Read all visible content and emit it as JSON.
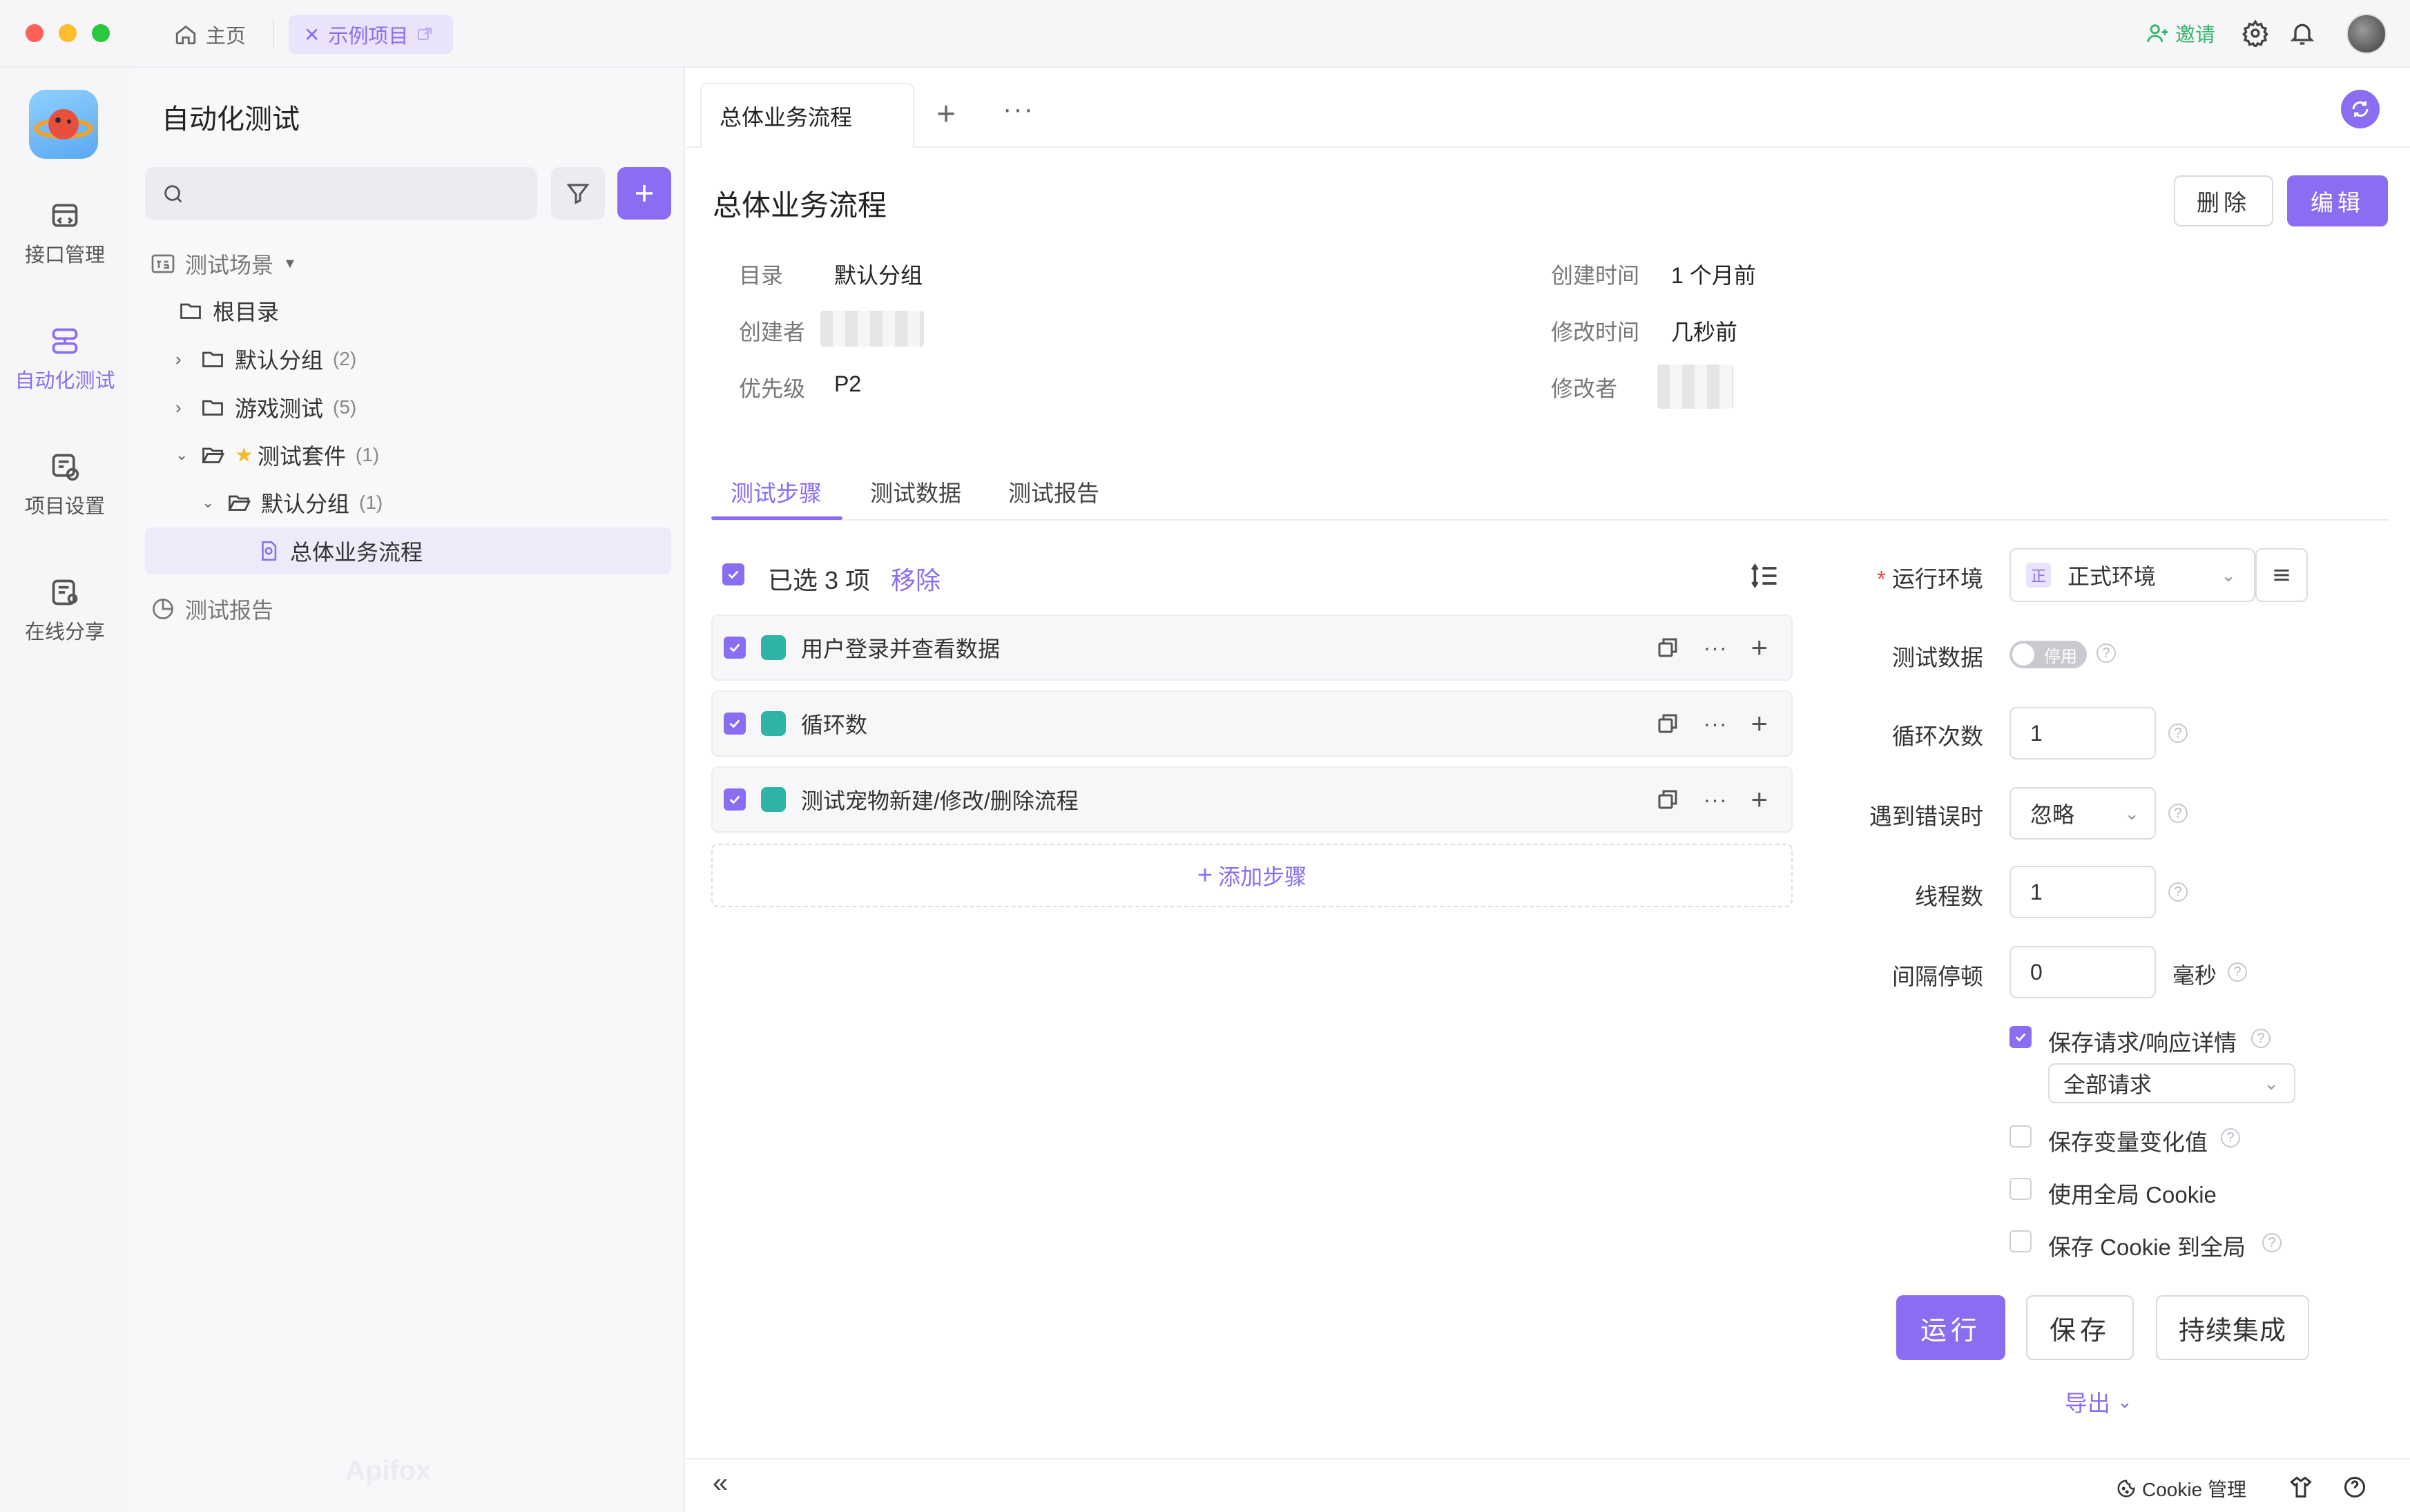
{
  "colors": {
    "accent": "#8a6df0",
    "invite_green": "#35b56d",
    "step_icon": "#2fb3a4",
    "close_red": "#fe5f57",
    "minimize_yellow": "#febc2e",
    "zoom_green": "#28c840"
  },
  "titlebar": {
    "home_tab": "主页",
    "project_tab": "示例项目",
    "invite": "邀请",
    "icons": [
      "home-icon",
      "close-icon",
      "external-link-icon",
      "user-plus-icon",
      "gear-icon",
      "bell-icon"
    ]
  },
  "rail": {
    "items": [
      {
        "label": "接口管理",
        "icon": "api-icon"
      },
      {
        "label": "自动化测试",
        "icon": "automation-icon",
        "active": true
      },
      {
        "label": "项目设置",
        "icon": "project-settings-icon"
      },
      {
        "label": "在线分享",
        "icon": "share-icon"
      }
    ]
  },
  "tree": {
    "title": "自动化测试",
    "section_scenes": "测试场景",
    "root": "根目录",
    "items": [
      {
        "label": "默认分组",
        "count": "(2)"
      },
      {
        "label": "游戏测试",
        "count": "(5)"
      },
      {
        "label": "测试套件",
        "count": "(1)"
      },
      {
        "label": "默认分组",
        "count": "(1)"
      },
      {
        "label": "总体业务流程",
        "count": ""
      }
    ],
    "section_reports": "测试报告",
    "watermark": "Apifox"
  },
  "main": {
    "tab_label": "总体业务流程",
    "title": "总体业务流程",
    "delete_label": "删除",
    "edit_label": "编辑",
    "meta": {
      "dir_label": "目录",
      "dir_value": "默认分组",
      "creator_label": "创建者",
      "priority_label": "优先级",
      "priority_value": "P2",
      "created_label": "创建时间",
      "created_value": "1 个月前",
      "modified_label": "修改时间",
      "modified_value": "几秒前",
      "modifier_label": "修改者"
    },
    "subtabs": [
      "测试步骤",
      "测试数据",
      "测试报告"
    ],
    "selected_text": "已选 3 项",
    "remove_label": "移除",
    "steps": [
      {
        "label": "用户登录并查看数据"
      },
      {
        "label": "循环数"
      },
      {
        "label": "测试宠物新建/修改/删除流程"
      }
    ],
    "add_step": "添加步骤"
  },
  "settings": {
    "env_label": "运行环境",
    "env_badge": "正",
    "env_value": "正式环境",
    "test_data_label": "测试数据",
    "test_data_toggle": "停用",
    "loop_label": "循环次数",
    "loop_value": "1",
    "on_error_label": "遇到错误时",
    "on_error_value": "忽略",
    "threads_label": "线程数",
    "threads_value": "1",
    "interval_label": "间隔停顿",
    "interval_value": "0",
    "interval_unit": "毫秒",
    "save_detail_label": "保存请求/响应详情",
    "save_detail_option": "全部请求",
    "save_vars_label": "保存变量变化值",
    "global_cookie_label": "使用全局 Cookie",
    "save_cookie_label": "保存 Cookie 到全局",
    "run_label": "运行",
    "save_label": "保存",
    "ci_label": "持续集成",
    "export_label": "导出"
  },
  "bottom": {
    "cookie_manager": "Cookie 管理"
  }
}
